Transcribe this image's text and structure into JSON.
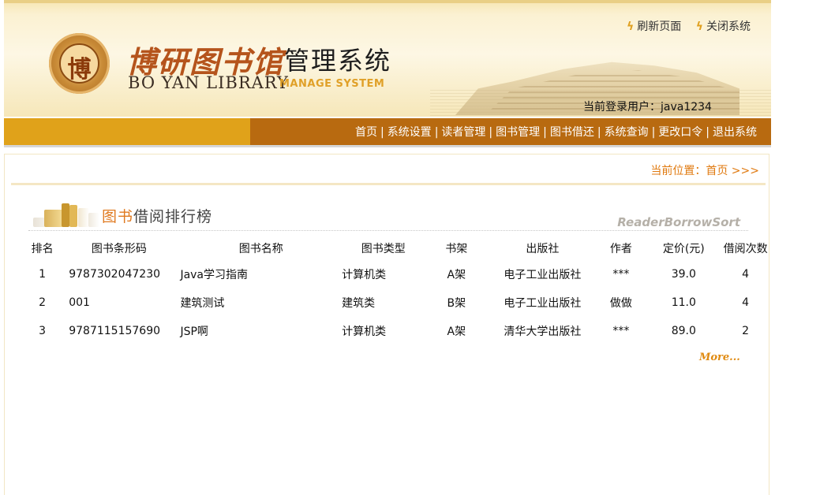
{
  "header": {
    "logo_cn": "博研图书馆",
    "logo_cn_suffix": "管理系统",
    "logo_en": "BO YAN LIBRARY",
    "logo_en_suffix": "MANAGE SYSTEM",
    "seal_char": "博",
    "refresh_label": "刷新页面",
    "close_label": "关闭系统",
    "current_user_label": "当前登录用户：",
    "current_user": "java1234"
  },
  "nav": {
    "items": [
      "首页",
      "系统设置",
      "读者管理",
      "图书管理",
      "图书借还",
      "系统查询",
      "更改口令",
      "退出系统"
    ]
  },
  "breadcrumb": "当前位置：首页 >>>",
  "section": {
    "title_prefix": "图书",
    "title_rest": "借阅排行榜",
    "title_en": "ReaderBorrowSort"
  },
  "table": {
    "headers": [
      "排名",
      "图书条形码",
      "图书名称",
      "图书类型",
      "书架",
      "出版社",
      "作者",
      "定价(元)",
      "借阅次数"
    ],
    "rows": [
      [
        "1",
        "9787302047230",
        "Java学习指南",
        "计算机类",
        "A架",
        "电子工业出版社",
        "***",
        "39.0",
        "4"
      ],
      [
        "2",
        "001",
        "建筑测试",
        "建筑类",
        "B架",
        "电子工业出版社",
        "做做",
        "11.0",
        "4"
      ],
      [
        "3",
        "9787115157690",
        "JSP啊",
        "计算机类",
        "A架",
        "清华大学出版社",
        "***",
        "89.0",
        "2"
      ]
    ]
  },
  "more_label": "More...",
  "colors": {
    "nav_gold": "#e0a21a",
    "nav_brown": "#b86a10",
    "accent_orange": "#e07a10"
  }
}
